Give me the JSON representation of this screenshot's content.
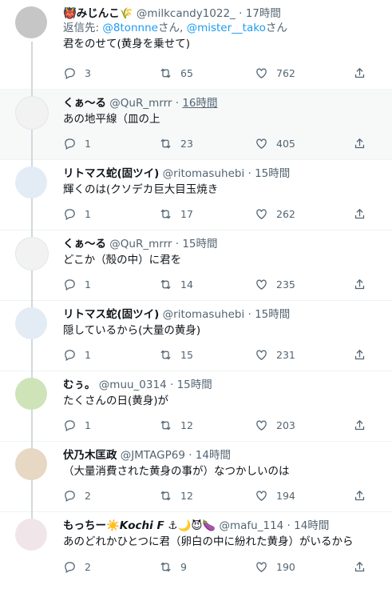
{
  "reply_prefix": "返信先:",
  "tweets": [
    {
      "name": "👹みじんこ🌾",
      "handle": "@milkcandy1022_",
      "time": "17時間",
      "reply_to": [
        "@8tonnne",
        "@mister__tako"
      ],
      "reply_suffix": "さん",
      "text": "君をのせて(黄身を乗せて)",
      "replies": "3",
      "retweets": "65",
      "likes": "762",
      "avatar": "#c6c6c6"
    },
    {
      "name": "くぁ～る",
      "handle": "@QuR_mrrr",
      "time": "16時間",
      "text": "あの地平線（皿の上",
      "replies": "1",
      "retweets": "23",
      "likes": "405",
      "avatar": "#f2f2f2",
      "highlight": true
    },
    {
      "name": "リトマス蛇(固ツイ)",
      "handle": "@ritomasuhebi",
      "time": "15時間",
      "text": "輝くのは(クソデカ巨大目玉焼き",
      "replies": "1",
      "retweets": "17",
      "likes": "262",
      "avatar": "#e3ecf5"
    },
    {
      "name": "くぁ～る",
      "handle": "@QuR_mrrr",
      "time": "15時間",
      "text": "どこか（殻の中）に君を",
      "replies": "1",
      "retweets": "14",
      "likes": "235",
      "avatar": "#f2f2f2"
    },
    {
      "name": "リトマス蛇(固ツイ)",
      "handle": "@ritomasuhebi",
      "time": "15時間",
      "text": "隠しているから(大量の黄身)",
      "replies": "1",
      "retweets": "15",
      "likes": "231",
      "avatar": "#e3ecf5"
    },
    {
      "name": "むぅ。",
      "handle": "@muu_0314",
      "time": "15時間",
      "text": "たくさんの日(黄身)が",
      "replies": "1",
      "retweets": "12",
      "likes": "203",
      "avatar": "#cfe3b8"
    },
    {
      "name": "伏乃木匡政",
      "handle": "@JMTAGP69",
      "time": "14時間",
      "text": "（大量消費された黄身の事が）なつかしいのは",
      "replies": "2",
      "retweets": "12",
      "likes": "194",
      "avatar": "#e6d8c2"
    },
    {
      "name": "もっちー☀️𝙆𝙤𝙘𝙝𝙞 𝙁 ⚓🌙😈🍆",
      "handle": "@mafu_114",
      "time": "14時間",
      "text": "あのどれかひとつに君（卵白の中に紛れた黄身）がいるから",
      "replies": "2",
      "retweets": "9",
      "likes": "190",
      "avatar": "#f0e6ea"
    }
  ]
}
